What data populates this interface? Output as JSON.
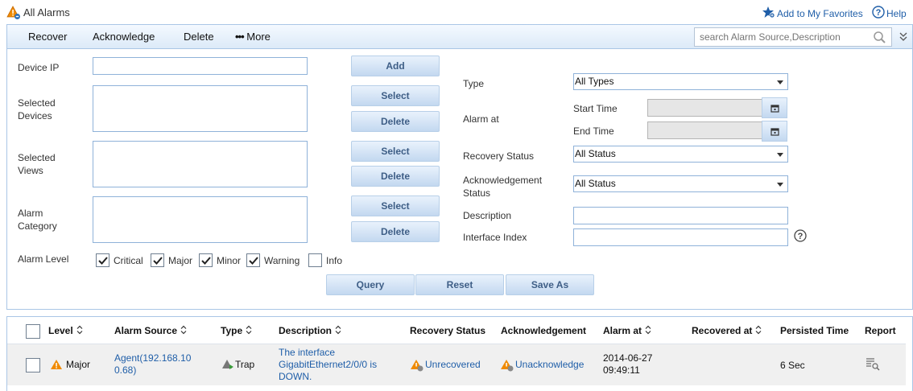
{
  "header": {
    "title": "All Alarms",
    "add_favorites": "Add to My Favorites",
    "help": "Help"
  },
  "toolbar": {
    "recover": "Recover",
    "acknowledge": "Acknowledge",
    "delete": "Delete",
    "more": "More",
    "search_placeholder": "search Alarm Source,Description"
  },
  "filter": {
    "device_ip_label": "Device IP",
    "device_ip_value": "",
    "selected_devices_label": "Selected Devices",
    "selected_views_label": "Selected Views",
    "alarm_category_label": "Alarm Category",
    "add_label": "Add",
    "select_label": "Select",
    "delete_label": "Delete",
    "alarm_level_label": "Alarm Level",
    "levels": [
      {
        "label": "Critical",
        "checked": true
      },
      {
        "label": "Major",
        "checked": true
      },
      {
        "label": "Minor",
        "checked": true
      },
      {
        "label": "Warning",
        "checked": true
      },
      {
        "label": "Info",
        "checked": false
      }
    ],
    "type_label": "Type",
    "type_value": "All Types",
    "alarm_at_label": "Alarm at",
    "start_time_label": "Start Time",
    "end_time_label": "End Time",
    "recovery_status_label": "Recovery Status",
    "recovery_status_value": "All Status",
    "ack_status_label": "Acknowledgement Status",
    "ack_status_value": "All Status",
    "description_label": "Description",
    "interface_index_label": "Interface Index",
    "query": "Query",
    "reset": "Reset",
    "save_as": "Save As"
  },
  "grid": {
    "columns": {
      "level": "Level",
      "alarm_source": "Alarm Source",
      "type": "Type",
      "description": "Description",
      "recovery_status": "Recovery Status",
      "acknowledgement": "Acknowledgement",
      "alarm_at": "Alarm at",
      "recovered_at": "Recovered at",
      "persisted_time": "Persisted Time",
      "report": "Report"
    },
    "rows": [
      {
        "level": "Major",
        "alarm_source": "Agent(192.168.10 0.68)",
        "type": "Trap",
        "description": "The interface GigabitEthernet2/0/0 is DOWN.",
        "recovery_status": "Unrecovered",
        "acknowledgement": "Unacknowledge",
        "alarm_at": "2014-06-27 09:49:11",
        "recovered_at": "",
        "persisted_time": "6 Sec"
      }
    ]
  },
  "colors": {
    "accent": "#1f5ea8",
    "major": "#f08a00",
    "toolbar_bg": "#dceaf8"
  }
}
